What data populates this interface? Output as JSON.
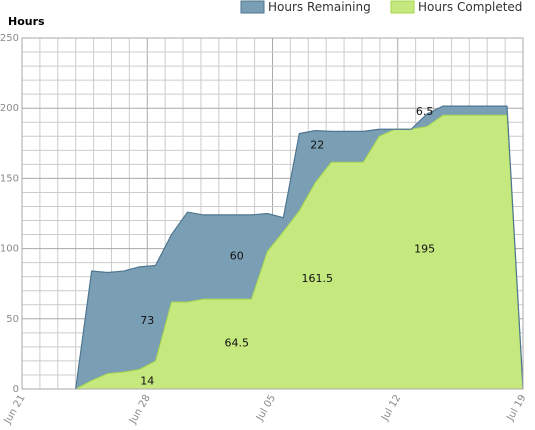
{
  "chart_data": {
    "type": "area",
    "ylabel": "Hours",
    "xlabel": "",
    "ylim": [
      0,
      250
    ],
    "xlim": [
      "2016-06-21",
      "2016-07-19"
    ],
    "x_tick_labels": [
      "Jun 21",
      "Jun 28",
      "Jul 05",
      "Jul 12",
      "Jul 19"
    ],
    "y_ticks": [
      0,
      50,
      100,
      150,
      200,
      250
    ],
    "grid": true,
    "legend_position": "top",
    "stacked": true,
    "x": [
      "2016-06-24",
      "2016-06-25",
      "2016-06-26",
      "2016-06-27",
      "2016-06-28",
      "2016-06-29",
      "2016-06-30",
      "2016-07-01",
      "2016-07-02",
      "2016-07-03",
      "2016-07-04",
      "2016-07-05",
      "2016-07-06",
      "2016-07-07",
      "2016-07-08",
      "2016-07-09",
      "2016-07-10",
      "2016-07-11",
      "2016-07-12",
      "2016-07-13",
      "2016-07-14",
      "2016-07-15",
      "2016-07-16",
      "2016-07-17",
      "2016-07-18",
      "2016-07-19"
    ],
    "series": [
      {
        "name": "Hours Completed",
        "color": "#c5e87f",
        "values": [
          0,
          6,
          11,
          12,
          14,
          20,
          62,
          62,
          64,
          64,
          64,
          64,
          98,
          112,
          127,
          147,
          161.5,
          161.5,
          161.5,
          180,
          185,
          185,
          187,
          195,
          195,
          195,
          195,
          195,
          0
        ]
      },
      {
        "name": "Hours Remaining",
        "color": "#7a9fb5",
        "values": [
          0,
          78,
          72,
          72,
          73,
          68,
          48,
          64,
          60,
          60,
          60,
          60,
          27,
          10,
          55,
          37,
          22,
          22,
          22,
          5,
          0,
          0,
          9,
          6.5,
          6.5,
          6.5,
          6.5,
          6.5,
          0
        ]
      }
    ],
    "annotations": [
      "14",
      "73",
      "64.5",
      "60",
      "161.5",
      "22",
      "195",
      "6.5"
    ],
    "colors": {
      "completed_fill": "#c5e87f",
      "completed_line": "#a8d64c",
      "remaining_fill": "#7a9fb5",
      "remaining_line": "#4f7690",
      "grid": "#cccccc"
    }
  }
}
